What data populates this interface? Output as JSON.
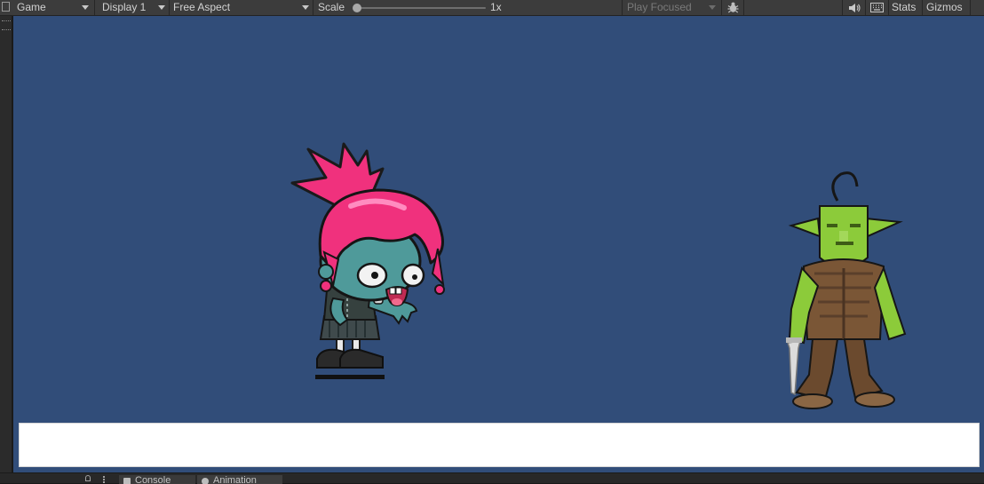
{
  "toolbar": {
    "view_dropdown": "Game",
    "display_dropdown": "Display 1",
    "aspect_dropdown": "Free Aspect",
    "scale_label": "Scale",
    "scale_value": "1x",
    "play_mode_dropdown": "Play Focused",
    "debug_icon": "bug-icon",
    "audio_icon": "speaker-icon",
    "shortcuts_icon": "keyboard-icon",
    "stats_button": "Stats",
    "gizmos_button": "Gizmos"
  },
  "viewport": {
    "background_color": "#314d79",
    "characters": [
      {
        "name": "zombie-girl",
        "hair_color": "#f0317d",
        "skin_color": "#4f9a9a"
      },
      {
        "name": "goblin",
        "skin_color": "#8ccb3a",
        "clothes_color": "#5a3f2b"
      }
    ]
  },
  "bottom_tabs": {
    "console_label": "Console",
    "animation_label": "Animation"
  }
}
